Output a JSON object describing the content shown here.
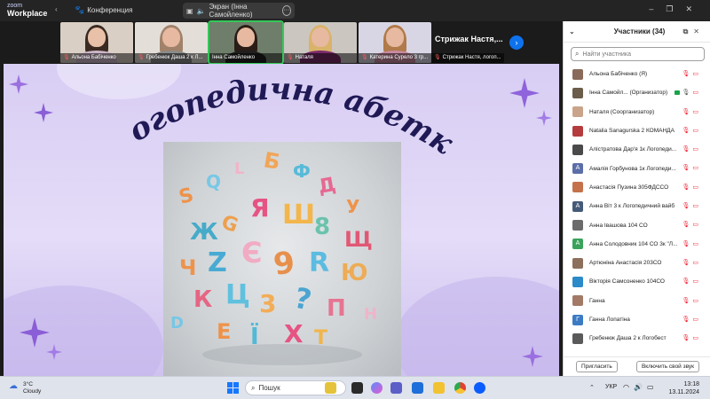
{
  "app": {
    "logo_line1": "zoom",
    "logo_line2": "Workplace",
    "meeting_title": "Конференция",
    "share_label": "Экран (Інна Самойленко)"
  },
  "thumbnails": [
    {
      "name": "Альона Бабіченко"
    },
    {
      "name": "Гребенюк Даша 2 к Л..."
    },
    {
      "name": "Інна Самойленко"
    },
    {
      "name": "Наталя"
    },
    {
      "name": "Катерина Сурело 3 гр..."
    },
    {
      "name": "Стрижак Настя, логоп...",
      "big": "Стрижак Настя,..."
    }
  ],
  "slide": {
    "title": "Логопедична абетка"
  },
  "participants": {
    "header": "Участники (34)",
    "search_placeholder": "Найти участника",
    "list": [
      {
        "name": "Альона Бабіченко (Я)",
        "avatar_color": "#8a6a5a",
        "avatar_letter": ""
      },
      {
        "name": "Інна Самойл... (Организатор)",
        "avatar_color": "#6c5c4a",
        "avatar_letter": ""
      },
      {
        "name": "Наталя (Соорганизатор)",
        "avatar_color": "#c9a48a",
        "avatar_letter": ""
      },
      {
        "name": "Natalia Sanagurska 2 КОМАНДА",
        "avatar_color": "#b43c3c",
        "avatar_letter": ""
      },
      {
        "name": "Алістратова Дар'я 1к Логопеди...",
        "avatar_color": "#4a4a4a",
        "avatar_letter": ""
      },
      {
        "name": "Амалія Горбунова 1к Логопеди...",
        "avatar_color": "#5b6ea8",
        "avatar_letter": "А"
      },
      {
        "name": "Анастасія Пузина 305ФДССО",
        "avatar_color": "#c5724a",
        "avatar_letter": ""
      },
      {
        "name": "Анна Віт 3 к Логопедичний вайб",
        "avatar_color": "#445a78",
        "avatar_letter": "А"
      },
      {
        "name": "Анна Івашова 104 СО",
        "avatar_color": "#6b6b6b",
        "avatar_letter": ""
      },
      {
        "name": "Анна Солодовник 104 СО 3к \"Л...",
        "avatar_color": "#3aa35a",
        "avatar_letter": "А"
      },
      {
        "name": "Артюніна Анастасія 203СО",
        "avatar_color": "#8c6f5c",
        "avatar_letter": ""
      },
      {
        "name": "Вікторія Самсоненко 104СО",
        "avatar_color": "#2b8ac8",
        "avatar_letter": ""
      },
      {
        "name": "Ганна",
        "avatar_color": "#a27a66",
        "avatar_letter": ""
      },
      {
        "name": "Ганна Лопатіна",
        "avatar_color": "#3c7bc4",
        "avatar_letter": "Г"
      },
      {
        "name": "Гребенюк Даша 2 к Логобест",
        "avatar_color": "#5a5a5a",
        "avatar_letter": ""
      }
    ],
    "invite_label": "Пригласить",
    "unmute_label": "Включить свой звук"
  },
  "taskbar": {
    "temperature": "3°C",
    "weather": "Cloudy",
    "search_label": "Пошук",
    "language": "УКР",
    "time": "13:18",
    "date": "13.11.2024"
  }
}
